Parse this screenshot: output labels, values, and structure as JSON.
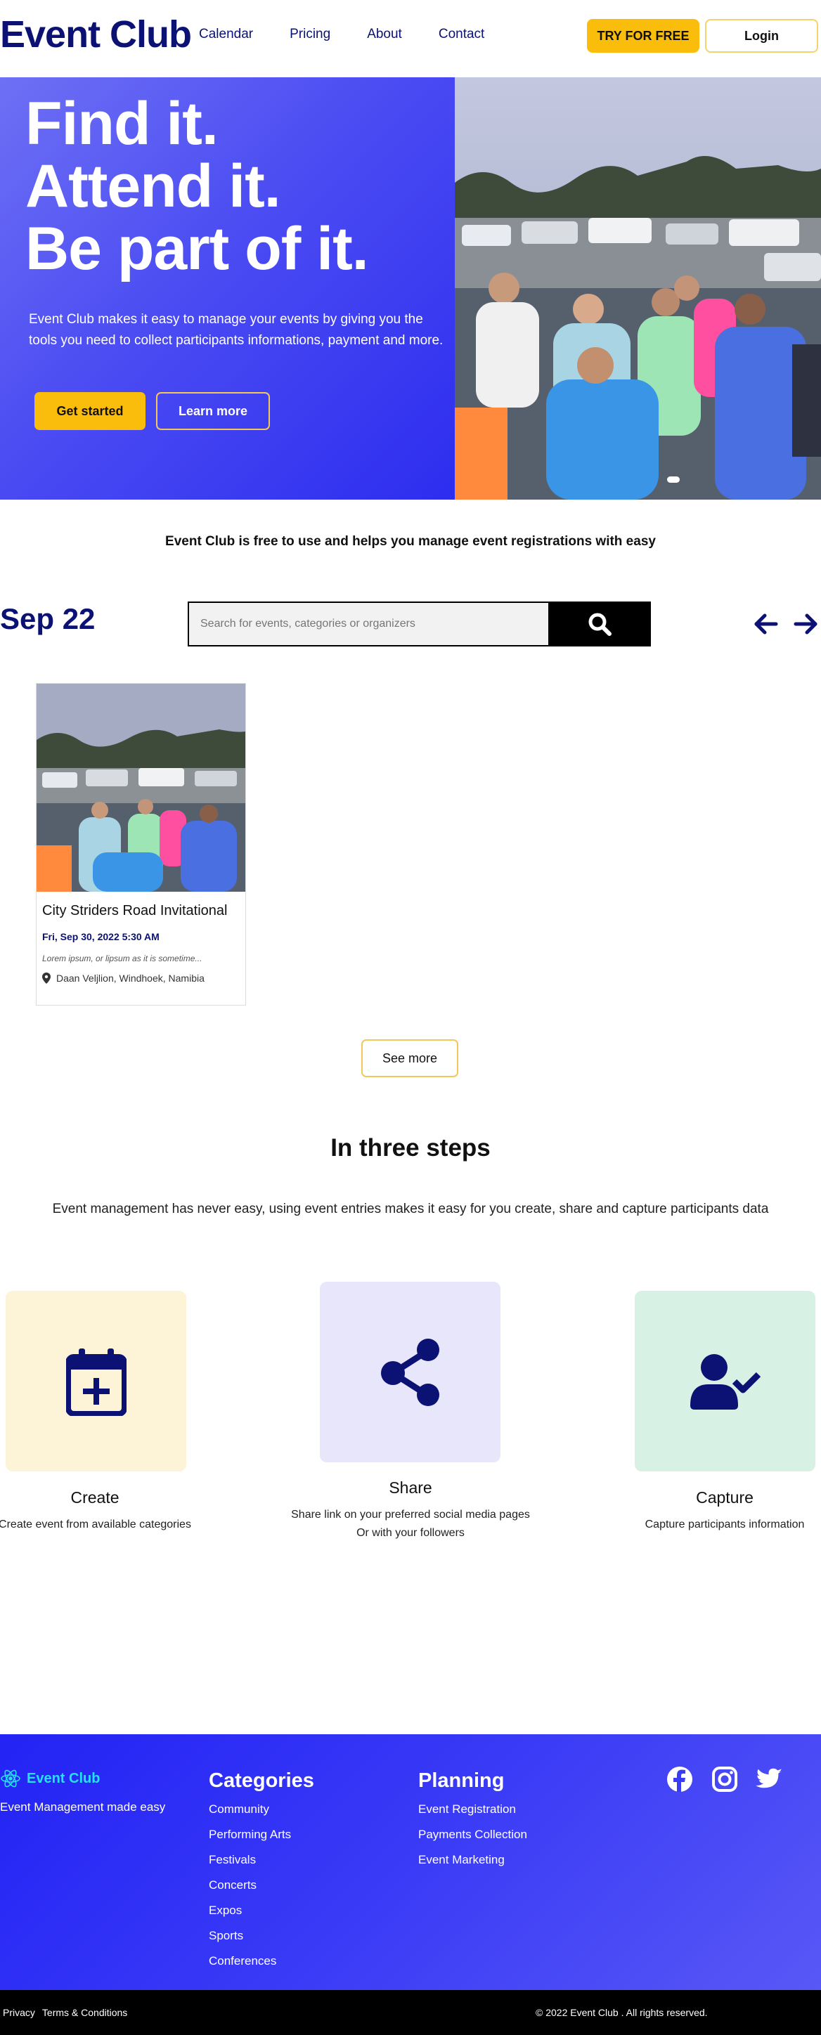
{
  "nav": {
    "brand": "Event Club",
    "links": [
      "Calendar",
      "Pricing",
      "About",
      "Contact"
    ],
    "try_label": "TRY FOR FREE",
    "login_label": "Login"
  },
  "hero": {
    "title_lines": [
      "Find it.",
      "Attend it.",
      "Be part of it."
    ],
    "description": "Event Club makes it easy to manage your events by giving you the tools you need to collect participants informations, payment and more.",
    "start_label": "Get started",
    "learn_label": "Learn more"
  },
  "tagline": "Event Club is free to use and helps you manage event registrations with easy",
  "search": {
    "date_label": "Sep 22",
    "placeholder": "Search for events, categories or organizers"
  },
  "event_card": {
    "title": "City Striders Road Invitational",
    "date": "Fri, Sep 30, 2022 5:30 AM",
    "description": "Lorem ipsum, or lipsum as it is sometime...",
    "location": "Daan Veljlion, Windhoek, Namibia"
  },
  "see_more_label": "See more",
  "steps": {
    "title": "In three steps",
    "subtitle": "Event management has never easy, using event entries makes it easy for you create, share and capture participants data",
    "items": [
      {
        "name": "Create",
        "desc": "Create event from available categories",
        "icon": "calendar-plus-icon",
        "bg": "#fdf3d6"
      },
      {
        "name": "Share",
        "desc": "Share link on your preferred social media pages\nOr with your followers",
        "icon": "share-icon",
        "bg": "#e8e6fb"
      },
      {
        "name": "Capture",
        "desc": "Capture participants information",
        "icon": "user-check-icon",
        "bg": "#d7f1e5"
      }
    ]
  },
  "footer": {
    "brand": "Event Club",
    "tagline": "Event Management made easy",
    "categories_title": "Categories",
    "categories": [
      "Community",
      "Performing Arts",
      "Festivals",
      "Concerts",
      "Expos",
      "Sports",
      "Conferences"
    ],
    "planning_title": "Planning",
    "planning": [
      "Event Registration",
      "Payments Collection",
      "Event Marketing"
    ],
    "social": [
      "facebook-icon",
      "instagram-icon",
      "twitter-icon"
    ],
    "privacy": "Privacy",
    "terms": "Terms & Conditions",
    "copyright": "© 2022 Event Club . All rights reserved."
  },
  "colors": {
    "brand_navy": "#0b1274",
    "accent_yellow": "#fbbd0c",
    "hero_blue": "#4b4cf2",
    "footer_blue": "#2323f5"
  }
}
